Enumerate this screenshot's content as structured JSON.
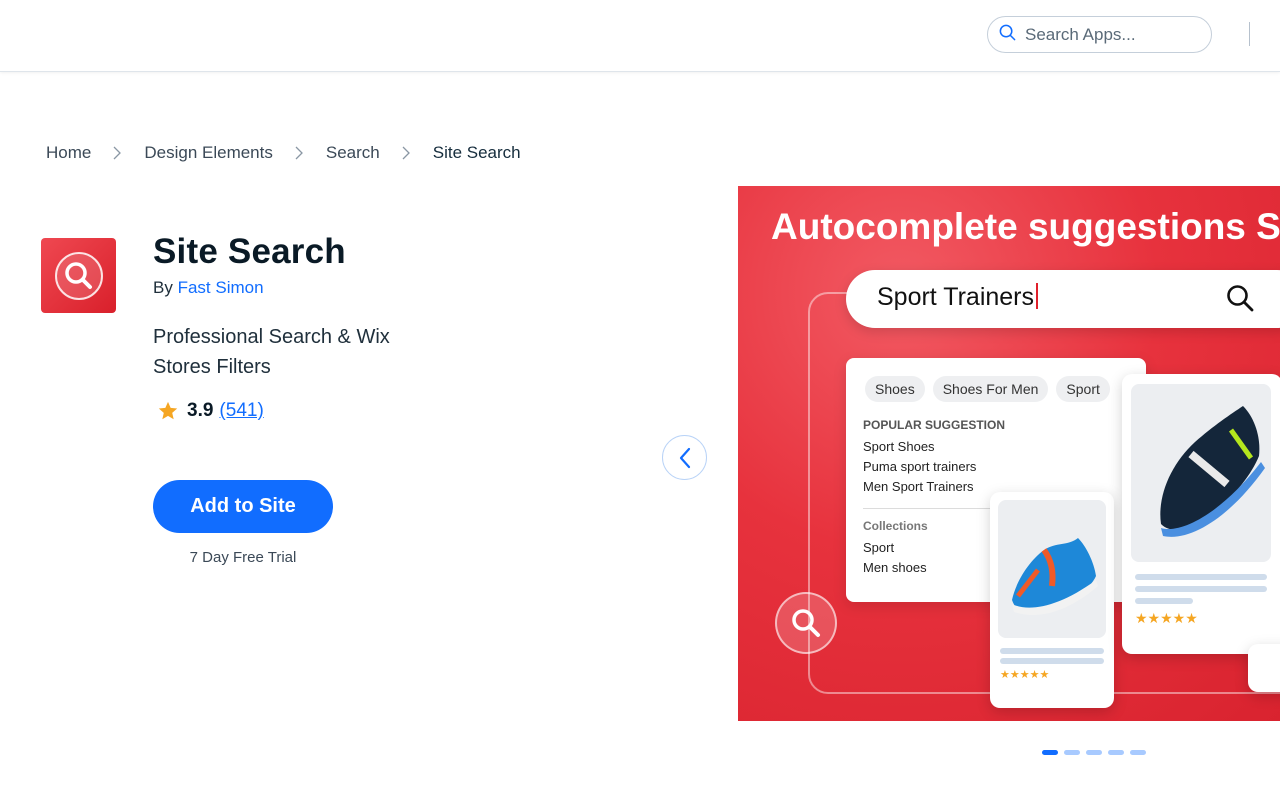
{
  "header": {
    "search_placeholder": "Search Apps..."
  },
  "breadcrumb": {
    "items": [
      "Home",
      "Design Elements",
      "Search",
      "Site Search"
    ]
  },
  "app": {
    "title": "Site Search",
    "by_label": "By",
    "developer": "Fast Simon",
    "tagline": "Professional Search & Wix Stores Filters",
    "rating": "3.9",
    "reviews": "(541)",
    "add_button": "Add to Site",
    "trial": "7 Day Free Trial",
    "icon": "magnifier-icon",
    "icon_color": "#e4303b"
  },
  "carousel": {
    "slide_title": "Autocomplete suggestions S",
    "search_text": "Sport Trainers",
    "chips": [
      "Shoes",
      "Shoes For Men",
      "Sport"
    ],
    "popular_heading": "POPULAR SUGGESTION",
    "popular": [
      "Sport Shoes",
      "Puma sport trainers",
      "Men Sport Trainers"
    ],
    "collections_heading": "Collections",
    "collections": [
      "Sport",
      "Men shoes"
    ],
    "stars": "★★★★★",
    "dots_count": 5,
    "active_dot": 1
  },
  "colors": {
    "accent": "#116dff",
    "brand_red": "#e4303b",
    "star": "#f5a623"
  }
}
